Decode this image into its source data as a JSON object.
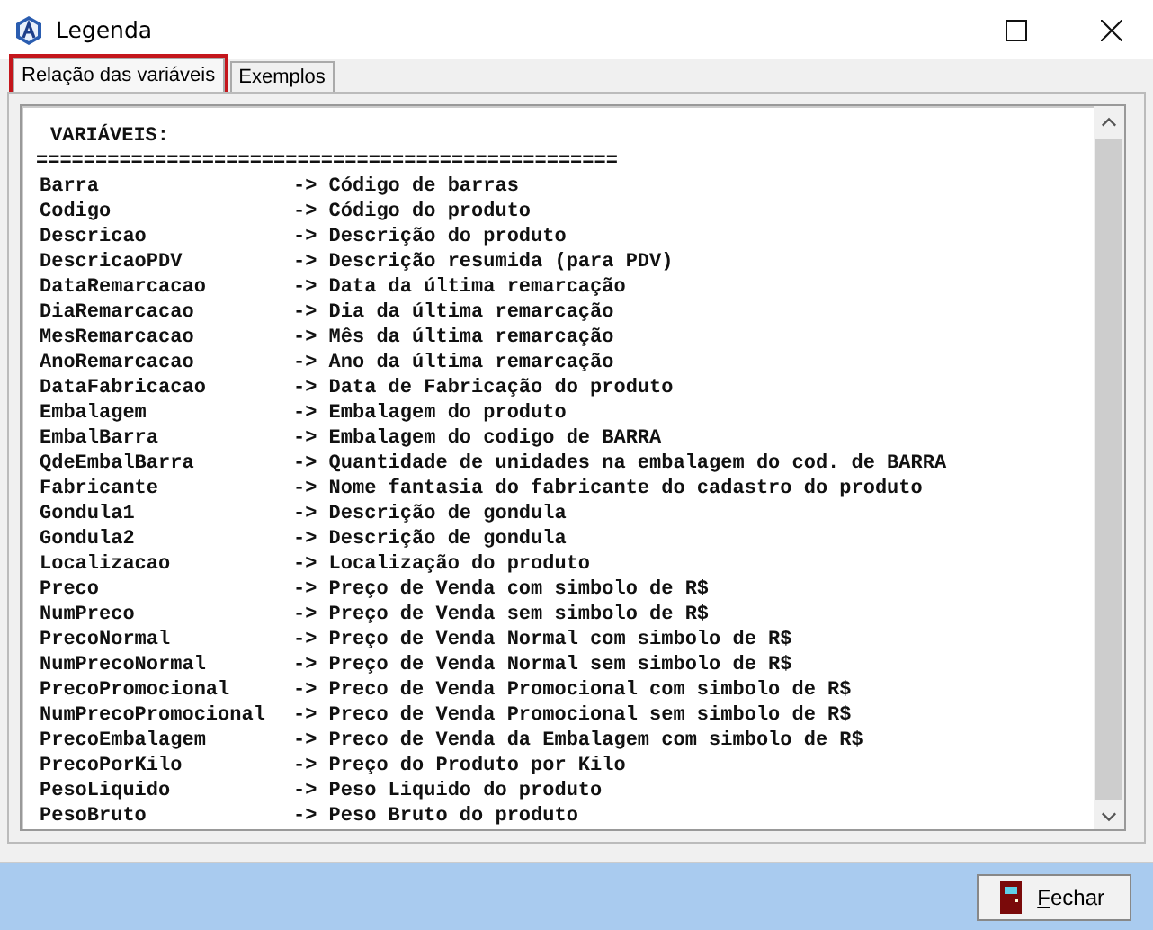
{
  "window": {
    "title": "Legenda"
  },
  "tabs": [
    {
      "label": "Relação das variáveis",
      "selected": true
    },
    {
      "label": "Exemplos",
      "selected": false
    }
  ],
  "listing": {
    "heading": "VARIÁVEIS:",
    "separator": "=================================================",
    "rows": [
      {
        "name": "Barra",
        "description": "-> Código de barras"
      },
      {
        "name": "Codigo",
        "description": "-> Código do produto"
      },
      {
        "name": "Descricao",
        "description": "-> Descrição do produto"
      },
      {
        "name": "DescricaoPDV",
        "description": "-> Descrição resumida (para PDV)"
      },
      {
        "name": "DataRemarcacao",
        "description": "-> Data da última remarcação"
      },
      {
        "name": "DiaRemarcacao",
        "description": "-> Dia da última remarcação"
      },
      {
        "name": "MesRemarcacao",
        "description": "-> Mês da última remarcação"
      },
      {
        "name": "AnoRemarcacao",
        "description": "-> Ano da última remarcação"
      },
      {
        "name": "DataFabricacao",
        "description": "-> Data de Fabricação do produto"
      },
      {
        "name": "Embalagem",
        "description": "-> Embalagem do produto"
      },
      {
        "name": "EmbalBarra",
        "description": "-> Embalagem do codigo de BARRA"
      },
      {
        "name": "QdeEmbalBarra",
        "description": "-> Quantidade de unidades na embalagem do cod. de BARRA"
      },
      {
        "name": "Fabricante",
        "description": "-> Nome fantasia do fabricante do cadastro do produto"
      },
      {
        "name": "Gondula1",
        "description": "-> Descrição de gondula"
      },
      {
        "name": "Gondula2",
        "description": "-> Descrição de gondula"
      },
      {
        "name": "Localizacao",
        "description": "-> Localização do produto"
      },
      {
        "name": "Preco",
        "description": "-> Preço de Venda com simbolo de R$"
      },
      {
        "name": "NumPreco",
        "description": "-> Preço de Venda sem simbolo de R$"
      },
      {
        "name": "PrecoNormal",
        "description": "-> Preço de Venda Normal com simbolo de R$"
      },
      {
        "name": "NumPrecoNormal",
        "description": "-> Preço de Venda Normal sem simbolo de R$"
      },
      {
        "name": "PrecoPromocional",
        "description": "-> Preco de Venda Promocional com simbolo de R$"
      },
      {
        "name": "NumPrecoPromocional",
        "description": "-> Preco de Venda Promocional sem simbolo de R$"
      },
      {
        "name": "PrecoEmbalagem",
        "description": "-> Preco de Venda da Embalagem com simbolo de R$"
      },
      {
        "name": "PrecoPorKilo",
        "description": "-> Preço do Produto por Kilo"
      },
      {
        "name": "PesoLiquido",
        "description": "-> Peso Liquido do produto"
      },
      {
        "name": "PesoBruto",
        "description": "-> Peso Bruto do produto"
      }
    ]
  },
  "footer": {
    "button": "Fechar"
  }
}
